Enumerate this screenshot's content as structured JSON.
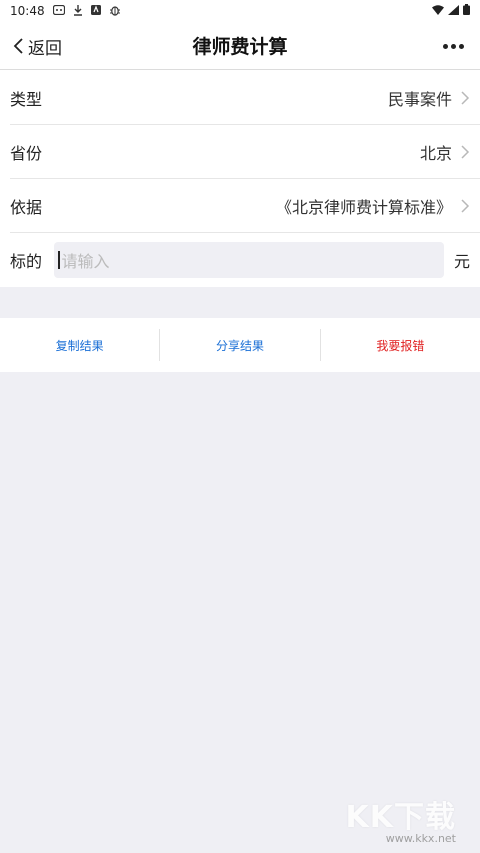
{
  "status_bar": {
    "time": "10:48",
    "icons": [
      "message-icon",
      "download-icon",
      "app-icon",
      "bug-icon"
    ],
    "right_icons": [
      "wifi-icon",
      "signal-icon",
      "battery-icon"
    ]
  },
  "nav": {
    "back_label": "返回",
    "title": "律师费计算"
  },
  "form": {
    "rows": [
      {
        "label": "类型",
        "value": "民事案件"
      },
      {
        "label": "省份",
        "value": "北京"
      },
      {
        "label": "依据",
        "value": "《北京律师费计算标准》"
      }
    ],
    "input": {
      "label": "标的",
      "placeholder": "请输入",
      "unit": "元"
    }
  },
  "actions": {
    "copy": "复制结果",
    "share": "分享结果",
    "report": "我要报错"
  },
  "watermark": {
    "big": "KK下载",
    "small": "www.kkx.net"
  }
}
